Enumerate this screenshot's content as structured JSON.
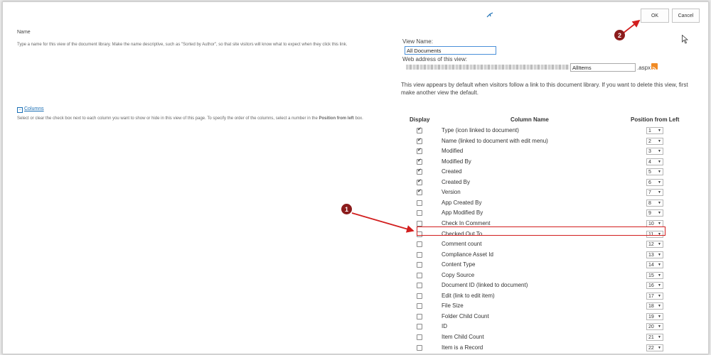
{
  "buttons": {
    "ok": "OK",
    "cancel": "Cancel"
  },
  "name_section": {
    "title": "Name",
    "description": "Type a name for this view of the document library. Make the name descriptive, such as \"Sorted by Author\", so that site visitors will know what to expect when they click this link.",
    "view_name_label": "View Name:",
    "view_name_value": "All Documents",
    "web_address_label": "Web address of this view:",
    "url_page_value": "AllItems",
    "url_suffix": ".aspx",
    "default_note": "This view appears by default when visitors follow a link to this document library. If you want to delete this view, first make another view the default."
  },
  "columns_section": {
    "title": "Columns",
    "description_pre": "Select or clear the check box next to each column you want to show or hide in this view of this page. To specify the order of the columns, select a number in the ",
    "description_bold": "Position from left",
    "description_post": " box.",
    "headers": {
      "display": "Display",
      "column_name": "Column Name",
      "position": "Position from Left"
    },
    "rows": [
      {
        "name": "Type (icon linked to document)",
        "checked": true,
        "pos": "1"
      },
      {
        "name": "Name (linked to document with edit menu)",
        "checked": true,
        "pos": "2"
      },
      {
        "name": "Modified",
        "checked": true,
        "pos": "3"
      },
      {
        "name": "Modified By",
        "checked": true,
        "pos": "4"
      },
      {
        "name": "Created",
        "checked": true,
        "pos": "5"
      },
      {
        "name": "Created By",
        "checked": true,
        "pos": "6"
      },
      {
        "name": "Version",
        "checked": true,
        "pos": "7"
      },
      {
        "name": "App Created By",
        "checked": false,
        "pos": "8"
      },
      {
        "name": "App Modified By",
        "checked": false,
        "pos": "9"
      },
      {
        "name": "Check In Comment",
        "checked": false,
        "pos": "10"
      },
      {
        "name": "Checked Out To",
        "checked": false,
        "pos": "11"
      },
      {
        "name": "Comment count",
        "checked": false,
        "pos": "12"
      },
      {
        "name": "Compliance Asset Id",
        "checked": false,
        "pos": "13"
      },
      {
        "name": "Content Type",
        "checked": false,
        "pos": "14"
      },
      {
        "name": "Copy Source",
        "checked": false,
        "pos": "15"
      },
      {
        "name": "Document ID (linked to document)",
        "checked": false,
        "pos": "16"
      },
      {
        "name": "Edit (link to edit item)",
        "checked": false,
        "pos": "17"
      },
      {
        "name": "File Size",
        "checked": false,
        "pos": "18"
      },
      {
        "name": "Folder Child Count",
        "checked": false,
        "pos": "19"
      },
      {
        "name": "ID",
        "checked": false,
        "pos": "20"
      },
      {
        "name": "Item Child Count",
        "checked": false,
        "pos": "21"
      },
      {
        "name": "Item is a Record",
        "checked": false,
        "pos": "22"
      }
    ]
  },
  "callouts": {
    "one": "1",
    "two": "2"
  },
  "colors": {
    "callout": "#8b1b1b",
    "arrow": "#d21e1e",
    "link": "#1a6fb5"
  }
}
